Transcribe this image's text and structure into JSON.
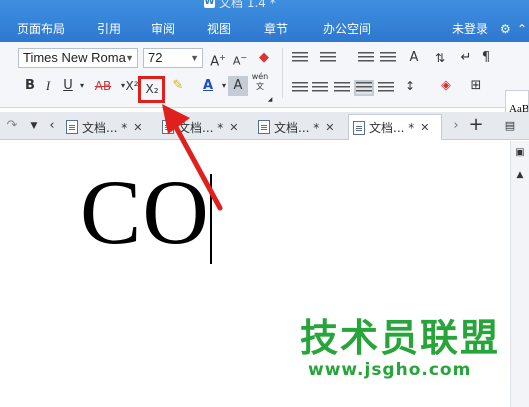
{
  "window": {
    "title": "文档 1.4 *"
  },
  "menu": {
    "items": [
      "页面布局",
      "引用",
      "审阅",
      "视图",
      "章节",
      "办公空间"
    ],
    "login": "未登录"
  },
  "ribbon": {
    "font_name": "Times New Roma",
    "font_size": "72",
    "bold": "B",
    "italic": "I",
    "underline": "U",
    "strikethrough": "AB",
    "superscript": "X²",
    "subscript": "X₂",
    "font_color_letter": "A",
    "char_shade_letter": "A",
    "phonetic": "wén",
    "grow_font": "A",
    "shrink_font": "A",
    "style_preview": "AaB"
  },
  "tabs": [
    {
      "label": "文档... *"
    },
    {
      "label": "文档... *"
    },
    {
      "label": "文档... *"
    },
    {
      "label": "文档... *"
    }
  ],
  "document": {
    "text": "CO"
  },
  "watermark": {
    "name": "技术员联盟",
    "url": "www.jsgho.com"
  },
  "colors": {
    "accent": "#2e78cf",
    "highlight": "#e0201c",
    "watermark": "#27a53a"
  }
}
